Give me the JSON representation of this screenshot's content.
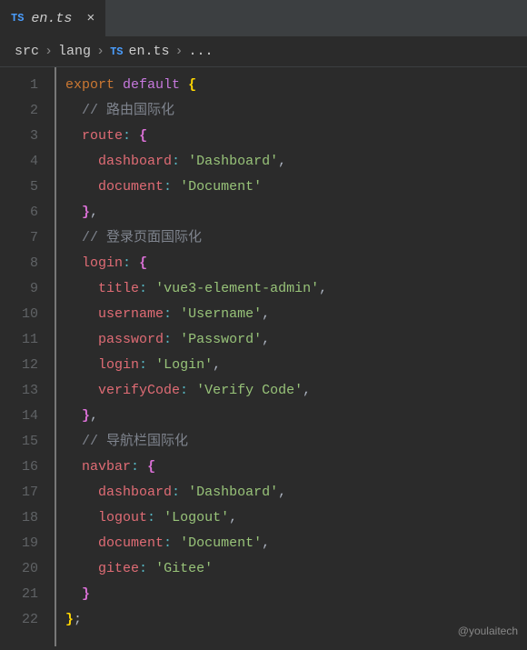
{
  "tab": {
    "icon": "TS",
    "name": "en.ts",
    "close": "×"
  },
  "breadcrumb": {
    "src": "src",
    "lang": "lang",
    "ts_icon": "TS",
    "file": "en.ts",
    "more": "..."
  },
  "lines": [
    "1",
    "2",
    "3",
    "4",
    "5",
    "6",
    "7",
    "8",
    "9",
    "10",
    "11",
    "12",
    "13",
    "14",
    "15",
    "16",
    "17",
    "18",
    "19",
    "20",
    "21",
    "22"
  ],
  "code": {
    "l1_export": "export",
    "l1_default": "default",
    "l1_brace": "{",
    "l2_comment": "// 路由国际化",
    "l3_key": "route",
    "l3_brace": "{",
    "l4_key": "dashboard",
    "l4_val": "'Dashboard'",
    "l5_key": "document",
    "l5_val": "'Document'",
    "l6_brace": "}",
    "l7_comment": "// 登录页面国际化",
    "l8_key": "login",
    "l8_brace": "{",
    "l9_key": "title",
    "l9_val": "'vue3-element-admin'",
    "l10_key": "username",
    "l10_val": "'Username'",
    "l11_key": "password",
    "l11_val": "'Password'",
    "l12_key": "login",
    "l12_val": "'Login'",
    "l13_key": "verifyCode",
    "l13_val": "'Verify Code'",
    "l14_brace": "}",
    "l15_comment": "// 导航栏国际化",
    "l16_key": "navbar",
    "l16_brace": "{",
    "l17_key": "dashboard",
    "l17_val": "'Dashboard'",
    "l18_key": "logout",
    "l18_val": "'Logout'",
    "l19_key": "document",
    "l19_val": "'Document'",
    "l20_key": "gitee",
    "l20_val": "'Gitee'",
    "l21_brace": "}",
    "l22_brace": "}",
    "l22_semi": ";"
  },
  "watermark": "@youlaitech"
}
